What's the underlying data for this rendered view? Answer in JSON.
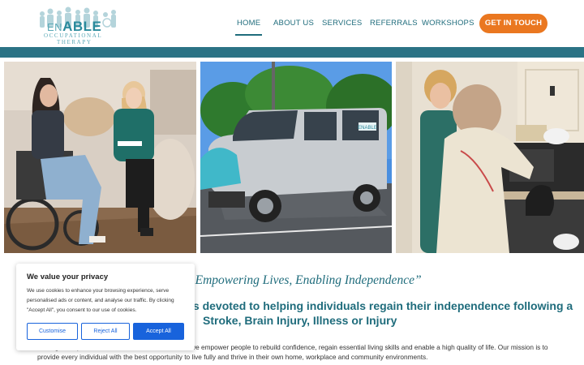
{
  "brand": {
    "logo_main": "ABLE",
    "logo_prefix": "EN",
    "logo_line1": "OCCUPATIONAL",
    "logo_line2": "THERAPY"
  },
  "nav": {
    "items": [
      "HOME",
      "ABOUT US",
      "SERVICES",
      "REFERRALS",
      "WORKSHOPS"
    ],
    "active": "HOME"
  },
  "cta": {
    "label": "GET IN TOUCH"
  },
  "hero": {
    "photo_captions": [
      "therapist-with-wheelchair-user",
      "company-van",
      "therapist-assisting-in-kitchen"
    ],
    "van_logo": "ENABLE"
  },
  "content": {
    "quote": "“Empowering Lives, Enabling Independence”",
    "heading_line1": "is devoted to helping individuals regain their independence following a",
    "heading_line2": "Stroke, Brain Injury, Illness or Injury",
    "body_line1": "Through compassionate and evidence-based care, we empower people to rebuild confidence, regain essential living skills and enable a high quality of life. Our mission is to",
    "body_line2": "provide every individual with the best opportunity to live fully and thrive in their own home, workplace and community environments."
  },
  "cookie_banner": {
    "title": "We value your privacy",
    "text": "We use cookies to enhance your browsing experience, serve personalised ads or content, and analyse our traffic. By clicking \"Accept All\", you consent to our use of cookies.",
    "customise": "Customise",
    "reject": "Reject All",
    "accept": "Accept All"
  },
  "colors": {
    "primary": "#1f6c7c",
    "band": "#2b7385",
    "cta": "#ea7720",
    "cookie_button": "#1863dc"
  }
}
